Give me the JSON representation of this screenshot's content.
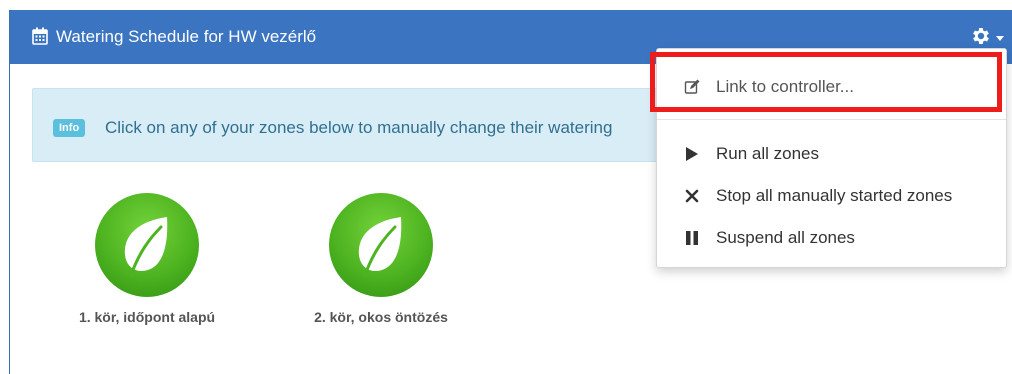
{
  "header": {
    "title": "Watering Schedule for HW vezérlő",
    "calendar_icon": "calendar-icon",
    "settings_icon": "gear-icon"
  },
  "info": {
    "badge": "Info",
    "text": "Click on any of your zones below to manually change their watering"
  },
  "zones": [
    {
      "label": "1. kör, időpont alapú",
      "icon": "leaf-icon"
    },
    {
      "label": "2. kör, okos öntözés",
      "icon": "leaf-icon"
    }
  ],
  "menu": {
    "items": [
      {
        "label": "Link to controller...",
        "icon": "edit-icon"
      },
      {
        "label": "Run all zones",
        "icon": "play-icon"
      },
      {
        "label": "Stop all manually started zones",
        "icon": "close-icon"
      },
      {
        "label": "Suspend all zones",
        "icon": "pause-icon"
      }
    ]
  },
  "colors": {
    "header_bg": "#3b74c1",
    "info_bg": "#d9edf7",
    "badge_bg": "#5bc0de",
    "zone_green": "#4db320",
    "highlight": "#ef1c1c"
  }
}
